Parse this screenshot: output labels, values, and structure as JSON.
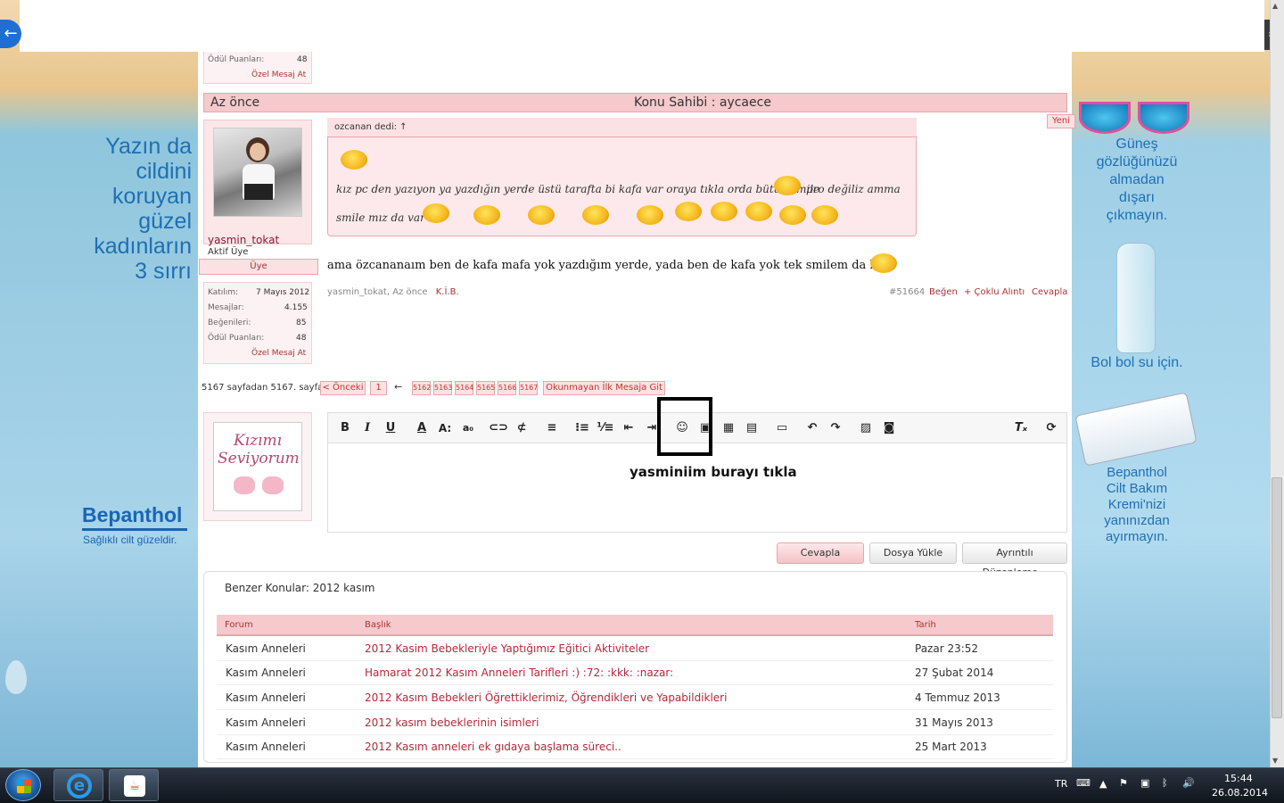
{
  "left_ad": {
    "headline": [
      "Yazın da",
      "cildini",
      "koruyan",
      "güzel",
      "kadınların",
      "3 sırrı"
    ],
    "brand": "Bepanthol",
    "brand_sub": "Sağlıklı cilt güzeldir."
  },
  "right_ad": {
    "tip1": [
      "Güneş",
      "gözlüğünüzü",
      "almadan",
      "dışarı",
      "çıkmayın."
    ],
    "tip2": "Bol bol su için.",
    "tip3": [
      "Bepanthol",
      "Cilt Bakım",
      "Kremi'nizi",
      "yanınızdan",
      "ayırmayın."
    ]
  },
  "prev_user_stats": {
    "odul_label": "Ödül Puanları:",
    "odul_value": "48",
    "pm_label": "Özel Mesaj At"
  },
  "post": {
    "time": "Az önce",
    "thread_owner": "Konu Sahibi : aycaece",
    "new_badge": "Yeni",
    "user": {
      "name": "yasmin_tokat",
      "title": "Aktif Üye",
      "rank": "Üye",
      "stats": [
        {
          "label": "Katılım:",
          "value": "7 Mayıs 2012"
        },
        {
          "label": "Mesajlar:",
          "value": "4.155"
        },
        {
          "label": "Beğenileri:",
          "value": "85"
        },
        {
          "label": "Ödül Puanları:",
          "value": "48"
        }
      ],
      "pm_label": "Özel Mesaj At"
    },
    "quote": {
      "header": "ozcanan dedi: ↑",
      "line1a": "kız pc den yazıyon ya yazdığın yerde üstü tarafta bi kafa var oraya tıkla orda bütün smile",
      "line1b": "pro değiliz amma",
      "line2": "smile mız da var"
    },
    "message": "ama özcananaım ben de kafa mafa yok yazdığım yerde, yada ben de kafa yok tek smilem da bu",
    "meta_author": "yasmin_tokat,",
    "meta_time": "Az önce",
    "meta_link": "K.İ.B.",
    "post_number": "#51664",
    "like": "Beğen",
    "multi_quote": "+ Çoklu Alıntı",
    "reply": "Cevapla"
  },
  "pagination": {
    "label": "5167 sayfadan 5167. sayfa",
    "prev": "< Önceki",
    "first": "1",
    "dots": "←",
    "pages": [
      "5162",
      "5163",
      "5164",
      "5165",
      "5166",
      "5167"
    ],
    "unread": "Okunmayan İlk Mesaja Git"
  },
  "editor": {
    "annotation": "yasminiim burayı tıkla",
    "buttons": {
      "reply": "Cevapla",
      "upload": "Dosya Yükle",
      "advanced": "Ayrıntılı Düzenleme..."
    }
  },
  "similar": {
    "title": "Benzer Konular: 2012 kasım",
    "headers": {
      "forum": "Forum",
      "title": "Başlık",
      "date": "Tarih"
    },
    "rows": [
      {
        "forum": "Kasım Anneleri",
        "title": "2012 Kasim Bebekleriyle Yaptığımız Eğitici Aktiviteler",
        "date": "Pazar 23:52"
      },
      {
        "forum": "Kasım Anneleri",
        "title": "Hamarat 2012 Kasım Anneleri Tarifleri :) :72: :kkk: :nazar:",
        "date": "27 Şubat 2014"
      },
      {
        "forum": "Kasım Anneleri",
        "title": "2012 Kasım Bebekleri Öğrettiklerimiz, Öğrendikleri ve Yapabildikleri",
        "date": "4 Temmuz 2013"
      },
      {
        "forum": "Kasım Anneleri",
        "title": "2012 kasım bebeklerinin isimleri",
        "date": "31 Mayıs 2013"
      },
      {
        "forum": "Kasım Anneleri",
        "title": "2012 Kasım anneleri ek gıdaya başlama süreci..",
        "date": "25 Mart 2013"
      }
    ]
  },
  "signature": {
    "text": [
      "Kızımı",
      "Seviyorum"
    ]
  },
  "taskbar": {
    "lang": "TR",
    "time": "15:44",
    "date": "26.08.2014"
  }
}
